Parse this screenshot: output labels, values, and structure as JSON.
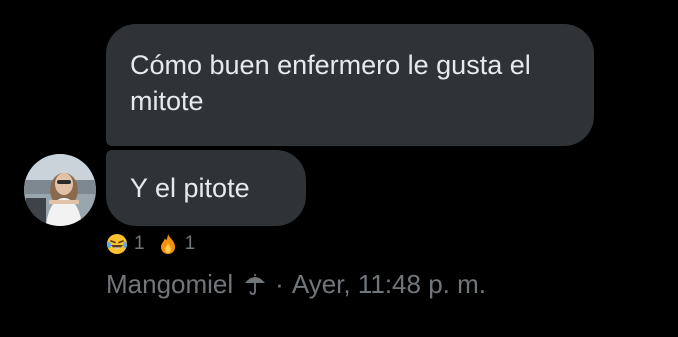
{
  "messages": [
    {
      "text": "Cómo buen enfermero le gusta el mitote"
    },
    {
      "text": "Y el pitote"
    }
  ],
  "reactions": [
    {
      "icon": "laughing-tears-emoji",
      "count": "1"
    },
    {
      "icon": "fire-emoji",
      "count": "1"
    }
  ],
  "meta": {
    "sender": "Mangomiel",
    "sender_icon": "umbrella-icon",
    "separator": "·",
    "timestamp": "Ayer, 11:48 p. m."
  },
  "colors": {
    "background": "#000000",
    "bubble": "#2f3336",
    "message_text": "#e7e9ea",
    "secondary_text": "#71767b"
  }
}
